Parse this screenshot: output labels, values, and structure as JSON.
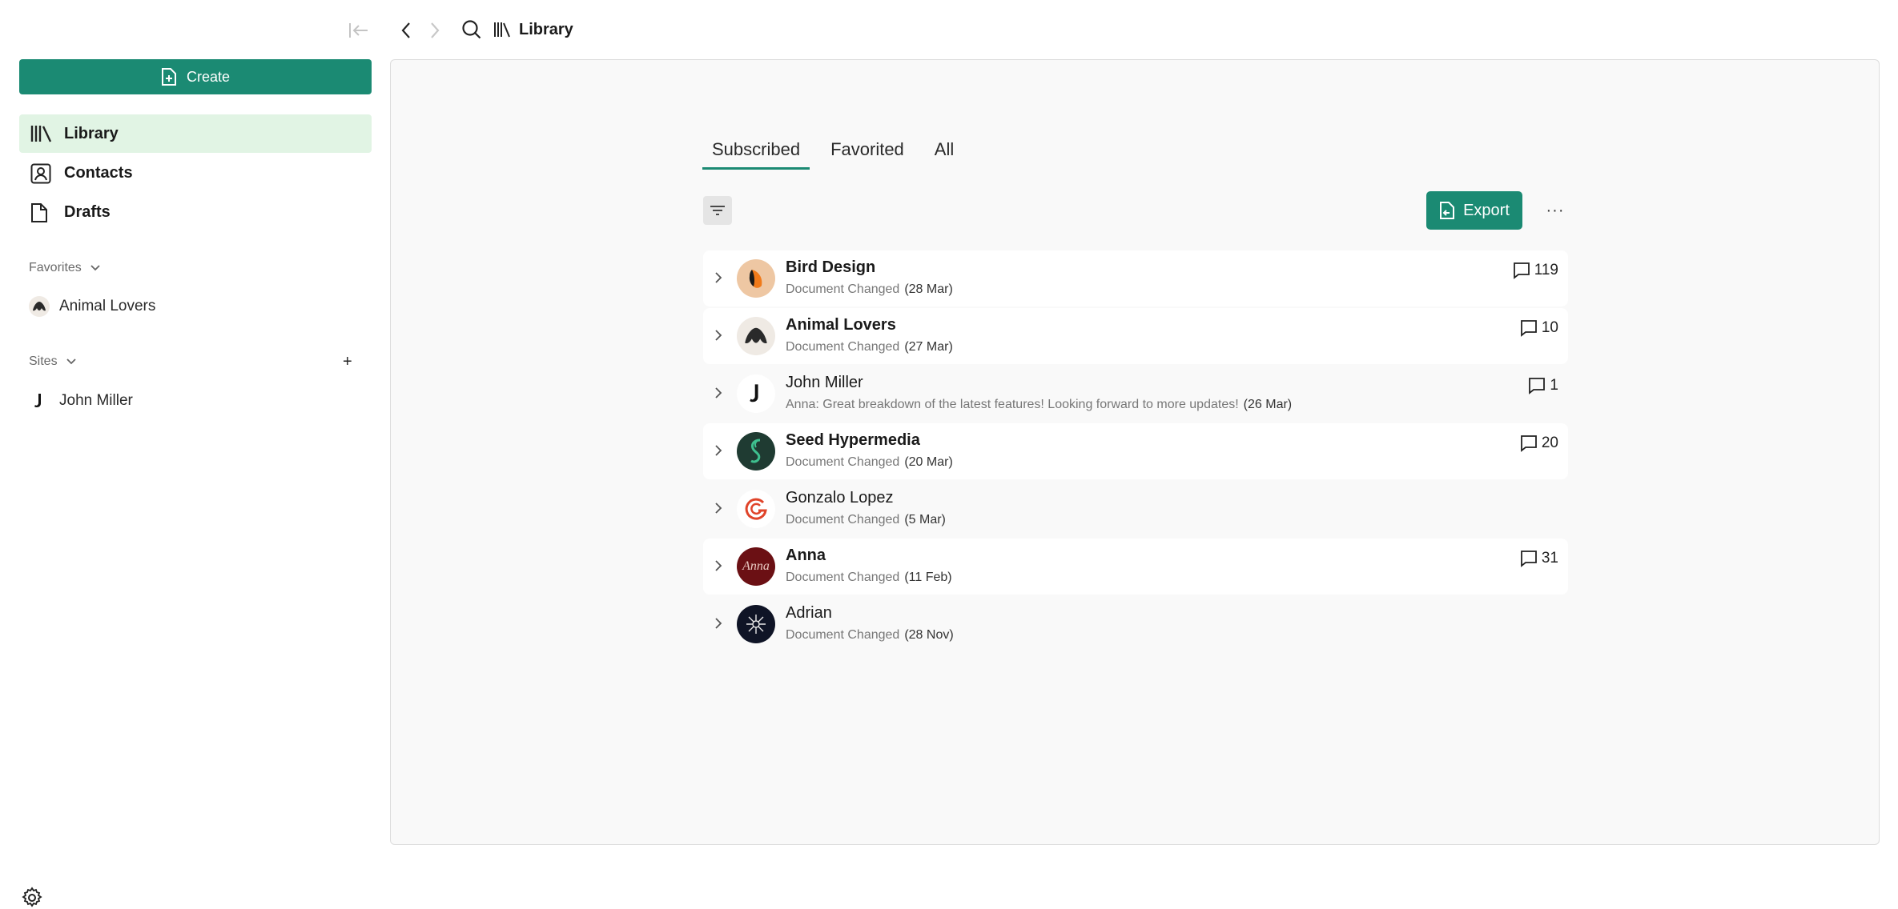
{
  "topbar": {
    "title": "Library"
  },
  "sidebar": {
    "create_label": "Create",
    "nav": [
      {
        "label": "Library",
        "icon": "library-icon",
        "active": true
      },
      {
        "label": "Contacts",
        "icon": "contact-icon",
        "active": false
      },
      {
        "label": "Drafts",
        "icon": "file-icon",
        "active": false
      }
    ],
    "favorites_label": "Favorites",
    "favorites": [
      {
        "label": "Animal Lovers"
      }
    ],
    "sites_label": "Sites",
    "sites": [
      {
        "label": "John Miller"
      }
    ]
  },
  "main": {
    "tabs": [
      {
        "label": "Subscribed",
        "active": true
      },
      {
        "label": "Favorited",
        "active": false
      },
      {
        "label": "All",
        "active": false
      }
    ],
    "export_label": "Export",
    "more_label": "···",
    "rows": [
      {
        "name": "Bird Design",
        "bold": true,
        "sub": "Document Changed",
        "date": "(28 Mar)",
        "count": "119"
      },
      {
        "name": "Animal Lovers",
        "bold": true,
        "sub": "Document Changed",
        "date": "(27 Mar)",
        "count": "10"
      },
      {
        "name": "John Miller",
        "bold": false,
        "sub": "Anna: Great breakdown of the latest features! Looking forward to more updates!",
        "date": "(26 Mar)",
        "count": "1"
      },
      {
        "name": "Seed Hypermedia",
        "bold": true,
        "sub": "Document Changed",
        "date": "(20 Mar)",
        "count": "20"
      },
      {
        "name": "Gonzalo Lopez",
        "bold": false,
        "sub": "Document Changed",
        "date": "(5 Mar)",
        "count": ""
      },
      {
        "name": "Anna",
        "bold": true,
        "sub": "Document Changed",
        "date": "(11 Feb)",
        "count": "31"
      },
      {
        "name": "Adrian",
        "bold": false,
        "sub": "Document Changed",
        "date": "(28 Nov)",
        "count": ""
      }
    ],
    "avatar_text_anna": "Anna"
  },
  "colors": {
    "accent": "#1b8a73",
    "active_nav": "#e1f4e4",
    "panel_bg": "#f9f9f9"
  }
}
